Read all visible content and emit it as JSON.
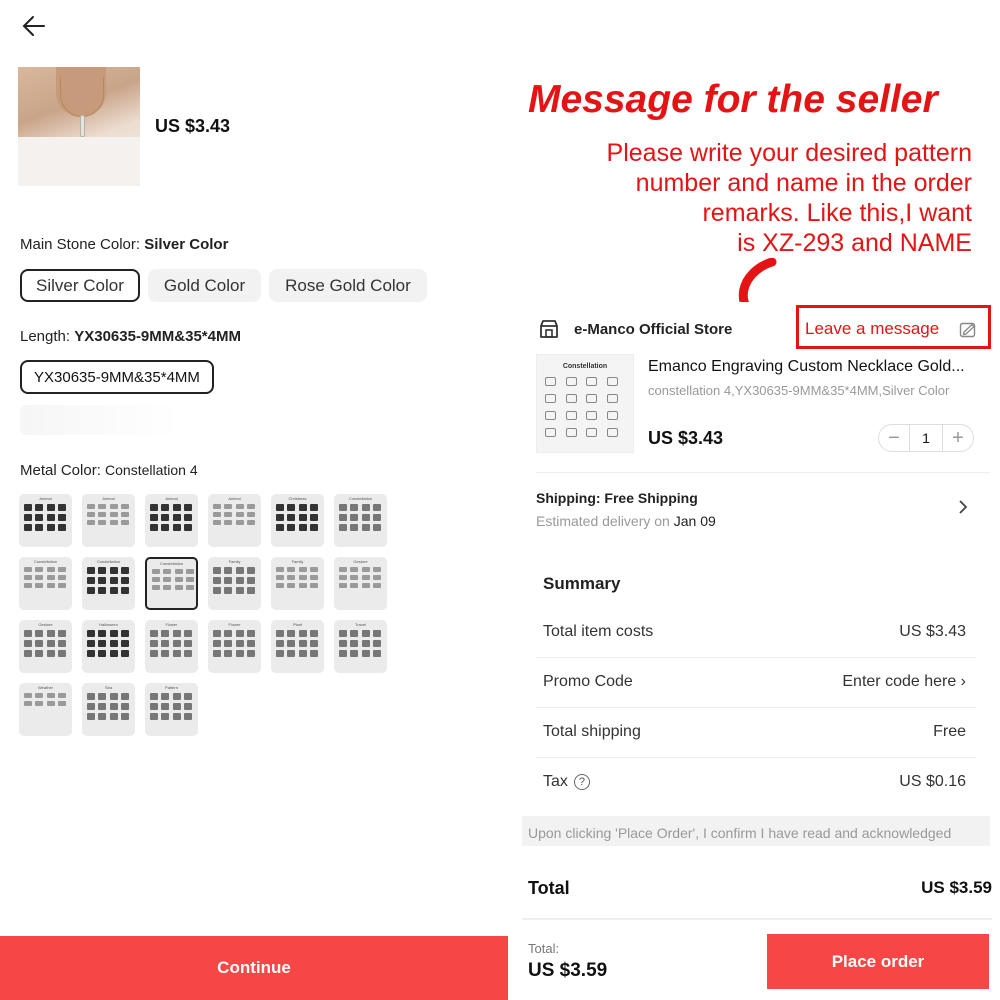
{
  "left": {
    "thumbnail_price": "US $3.43",
    "main_stone_label": "Main Stone Color:",
    "main_stone_value": "Silver Color",
    "colors": [
      "Silver Color",
      "Gold Color",
      "Rose Gold Color"
    ],
    "length_label": "Length:",
    "length_value": "YX30635-9MM&35*4MM",
    "length_option": "YX30635-9MM&35*4MM",
    "metal_label": "Metal Color:",
    "metal_value": "Constellation 4",
    "patterns": [
      "Animal",
      "Animal",
      "Animal",
      "Animal",
      "Christmas",
      "Constellation",
      "Constellation",
      "Constellation",
      "Constellation",
      "Family",
      "Family",
      "Gesture",
      "Gesture",
      "Halloween",
      "Flower",
      "Flower",
      "Plant",
      "Travel",
      "Weather",
      "Sea",
      "Pattern"
    ],
    "continue_label": "Continue"
  },
  "right": {
    "headline": "Message for the seller",
    "instructions": [
      "Please write your desired pattern",
      "number and name in the order",
      "remarks. Like this,I want",
      "is XZ-293 and NAME"
    ],
    "store_name": "e-Manco Official Store",
    "leave_message": "Leave a message",
    "product": {
      "image_title": "Constellation",
      "title": "Emanco Engraving Custom Necklace Gold...",
      "variant": "constellation 4,YX30635-9MM&35*4MM,Silver Color",
      "price": "US $3.43",
      "quantity": "1",
      "minus": "−",
      "plus": "+"
    },
    "shipping": {
      "title": "Shipping: Free Shipping",
      "eta_label": "Estimated delivery on",
      "eta_date": "Jan 09"
    },
    "summary": {
      "title": "Summary",
      "rows": [
        {
          "label": "Total item costs",
          "value": "US $3.43"
        },
        {
          "label": "Promo Code",
          "value": "Enter code here ›"
        },
        {
          "label": "Total shipping",
          "value": "Free"
        },
        {
          "label": "Tax",
          "value": "US $0.16"
        }
      ]
    },
    "disclaimer": "Upon clicking 'Place Order', I confirm I have read and acknowledged",
    "total_label": "Total",
    "total_value": "US $3.59",
    "footer_total_label": "Total:",
    "footer_total_value": "US $3.59",
    "place_order_label": "Place order"
  },
  "colors": {
    "accent_red": "#f74646",
    "annotation_red": "#e41414"
  },
  "icons": [
    "back-arrow-icon",
    "store-icon",
    "edit-icon",
    "chevron-right-icon",
    "question-circle-icon",
    "curved-arrow-icon"
  ]
}
